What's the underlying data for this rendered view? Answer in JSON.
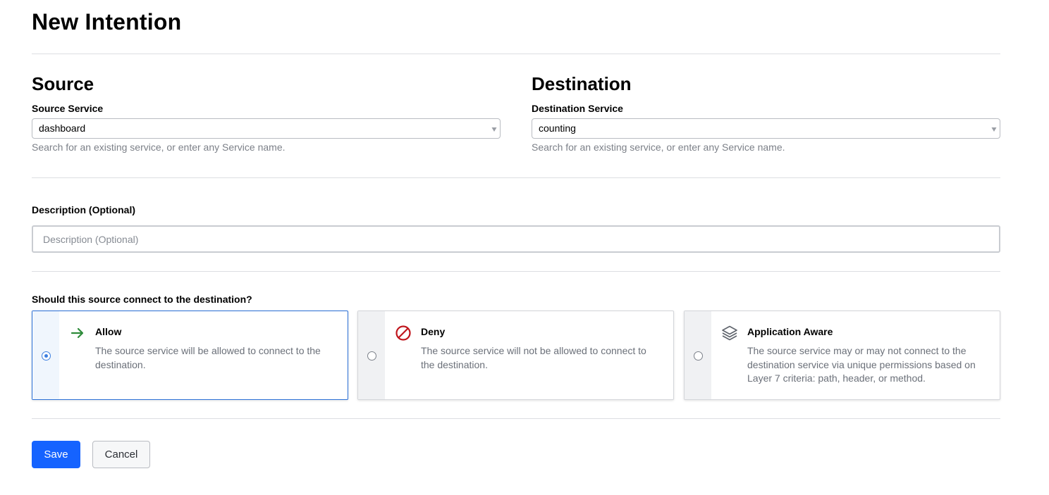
{
  "page": {
    "title": "New Intention"
  },
  "source": {
    "heading": "Source",
    "label": "Source Service",
    "value": "dashboard",
    "help": "Search for an existing service, or enter any Service name."
  },
  "destination": {
    "heading": "Destination",
    "label": "Destination Service",
    "value": "counting",
    "help": "Search for an existing service, or enter any Service name."
  },
  "description": {
    "label": "Description (Optional)",
    "placeholder": "Description (Optional)",
    "value": ""
  },
  "action": {
    "question": "Should this source connect to the destination?",
    "selected": "allow",
    "options": [
      {
        "id": "allow",
        "title": "Allow",
        "text": "The source service will be allowed to connect to the destination.",
        "icon": "arrow-right-icon",
        "color": "#2e8b3a"
      },
      {
        "id": "deny",
        "title": "Deny",
        "text": "The source service will not be allowed to connect to the destination.",
        "icon": "deny-icon",
        "color": "#c0161d"
      },
      {
        "id": "app-aware",
        "title": "Application Aware",
        "text": "The source service may or may not connect to the destination service via unique permissions based on Layer 7 criteria: path, header, or method.",
        "icon": "layers-icon",
        "color": "#5f646c"
      }
    ]
  },
  "buttons": {
    "save": "Save",
    "cancel": "Cancel"
  },
  "colors": {
    "primary": "#1563ff",
    "selected_border": "#2a6fd6",
    "radio_selected": "#3d7fe0"
  }
}
